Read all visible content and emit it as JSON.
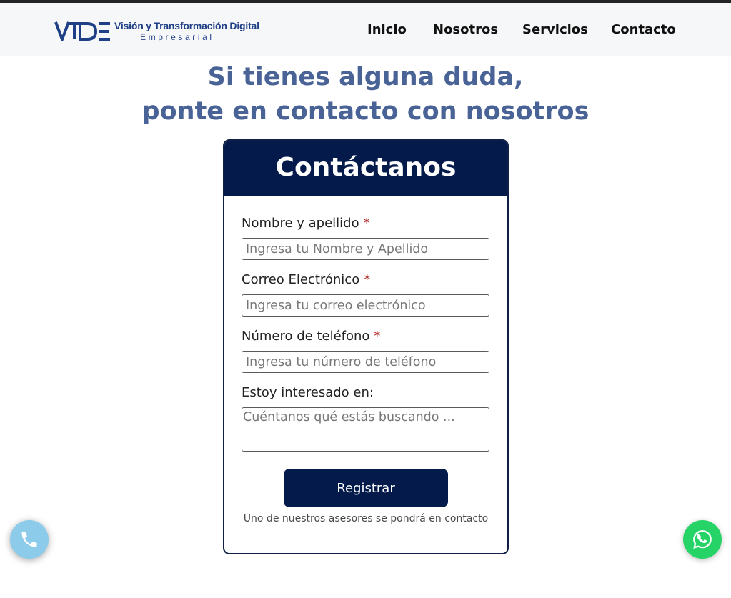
{
  "brand": {
    "logo_line1": "Visión y Transformación Digital",
    "logo_line2": "Empresarial",
    "color": "#1f3f86"
  },
  "nav": {
    "items": [
      {
        "label": "Inicio"
      },
      {
        "label": "Nosotros"
      },
      {
        "label": "Servicios"
      },
      {
        "label": "Contacto"
      }
    ]
  },
  "hero": {
    "line1": "Si tienes alguna duda,",
    "line2": "ponte en contacto con nosotros",
    "color": "#4a6396"
  },
  "form": {
    "title": "Contáctanos",
    "required_mark": "*",
    "fields": [
      {
        "label": "Nombre y apellido",
        "placeholder": "Ingresa tu Nombre y Apellido",
        "value": ""
      },
      {
        "label": "Correo Electrónico",
        "placeholder": "Ingresa tu correo electrónico",
        "value": ""
      },
      {
        "label": "Número de teléfono",
        "placeholder": "Ingresa tu número de teléfono",
        "value": ""
      }
    ],
    "interest": {
      "label": "Estoy interesado en:",
      "placeholder": "Cuéntanos qué estás buscando ...",
      "value": ""
    },
    "submit_label": "Registrar",
    "note": "Uno de nuestros asesores se pondrá en contacto",
    "header_color": "#041a4a"
  },
  "floating": {
    "phone_icon": "phone-icon",
    "whatsapp_icon": "whatsapp-icon"
  }
}
